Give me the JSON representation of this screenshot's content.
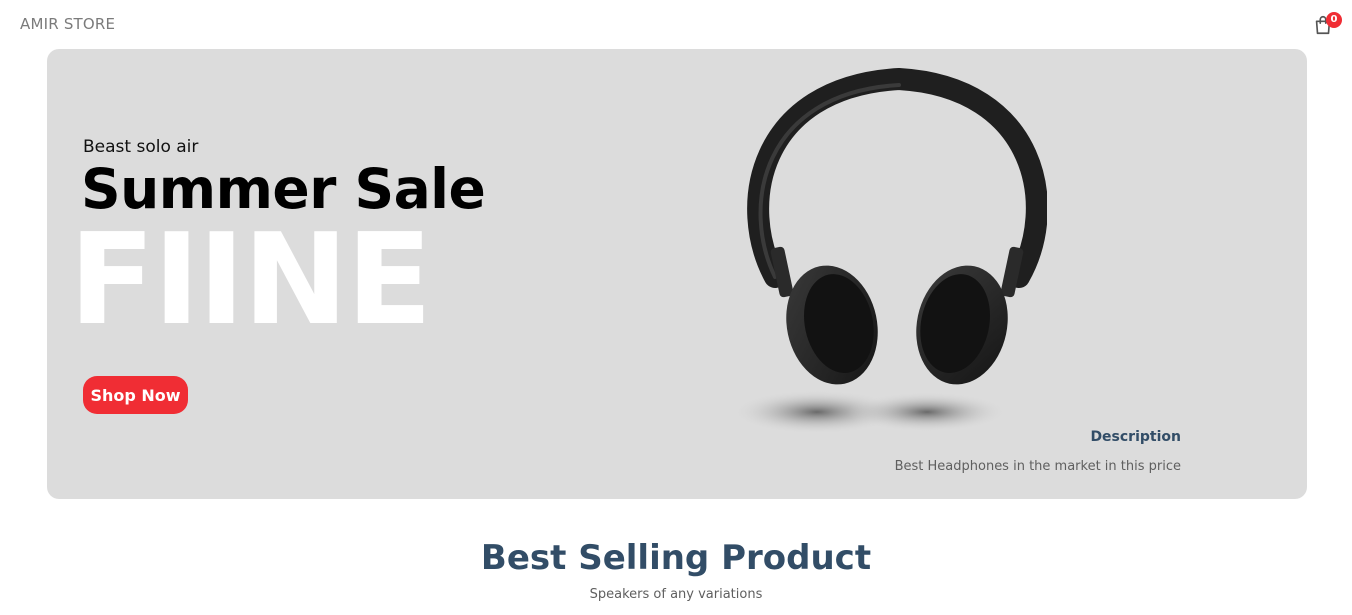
{
  "navbar": {
    "logo": "AMIR STORE",
    "cart_count": "0"
  },
  "hero": {
    "small_text": "Beast solo air",
    "mid_text": "Summer Sale",
    "large_text": "FIINE",
    "button_label": "Shop Now",
    "description_title": "Description",
    "description_text": "Best Headphones in the market in this price"
  },
  "products": {
    "title": "Best Selling Product",
    "subtitle": "Speakers of any variations"
  },
  "colors": {
    "accent": "#f02d34",
    "heading": "#324d67",
    "banner_bg": "#dcdcdc"
  }
}
